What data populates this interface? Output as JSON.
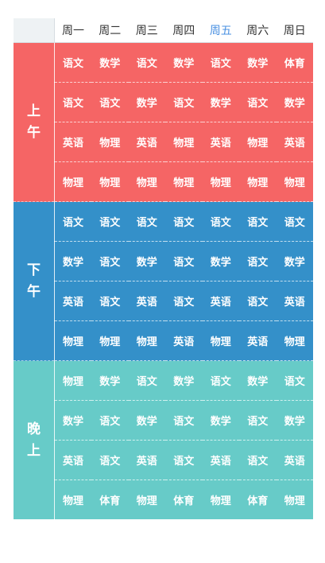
{
  "days": [
    "周一",
    "周二",
    "周三",
    "周四",
    "周五",
    "周六",
    "周日"
  ],
  "active_day_index": 4,
  "colors": {
    "active_day": "#4a90e2",
    "morning": "#f56565",
    "afternoon": "#3490c9",
    "evening": "#67cbc8"
  },
  "periods": [
    {
      "label": [
        "上",
        "午"
      ],
      "color": "#f56565",
      "rows": [
        [
          "语文",
          "数学",
          "语文",
          "数学",
          "语文",
          "数学",
          "体育"
        ],
        [
          "语文",
          "语文",
          "数学",
          "语文",
          "数学",
          "语文",
          "数学"
        ],
        [
          "英语",
          "物理",
          "英语",
          "物理",
          "英语",
          "物理",
          "英语"
        ],
        [
          "物理",
          "物理",
          "物理",
          "物理",
          "物理",
          "物理",
          "物理"
        ]
      ]
    },
    {
      "label": [
        "下",
        "午"
      ],
      "color": "#3490c9",
      "rows": [
        [
          "语文",
          "语文",
          "语文",
          "语文",
          "语文",
          "语文",
          "语文"
        ],
        [
          "数学",
          "语文",
          "数学",
          "语文",
          "数学",
          "语文",
          "数学"
        ],
        [
          "英语",
          "语文",
          "英语",
          "语文",
          "英语",
          "语文",
          "英语"
        ],
        [
          "物理",
          "物理",
          "物理",
          "英语",
          "物理",
          "英语",
          "物理"
        ]
      ]
    },
    {
      "label": [
        "晚",
        "上"
      ],
      "color": "#67cbc8",
      "rows": [
        [
          "物理",
          "数学",
          "语文",
          "数学",
          "语文",
          "数学",
          "语文"
        ],
        [
          "数学",
          "语文",
          "数学",
          "语文",
          "数学",
          "语文",
          "数学"
        ],
        [
          "英语",
          "语文",
          "英语",
          "语文",
          "英语",
          "语文",
          "英语"
        ],
        [
          "物理",
          "体育",
          "物理",
          "体育",
          "物理",
          "体育",
          "物理"
        ]
      ]
    }
  ]
}
